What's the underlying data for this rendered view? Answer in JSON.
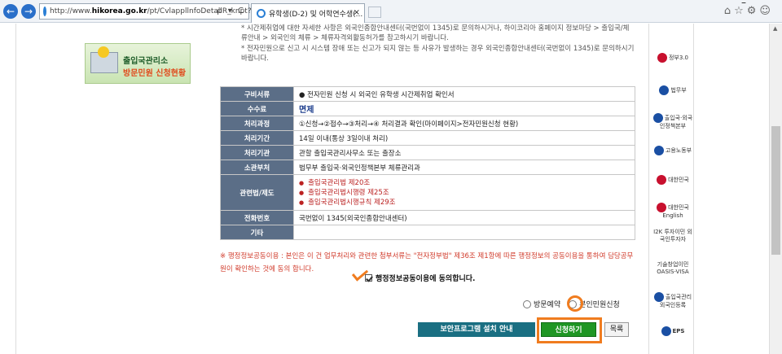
{
  "browser": {
    "url_prefix": "http://www.",
    "url_domain": "hikorea.go.kr",
    "url_rest": "/pt/CvlappllnfoDetailR_kr.pt?",
    "addr_controls": "ρ ▾ C",
    "tab_title": "유학생(D-2) 및 어학연수생(...",
    "tab_close": "×",
    "tool_icons": "⌂☆⚙☺",
    "minimize": "–",
    "back": "←",
    "forward": "→"
  },
  "notice": {
    "line1": "* 시간제취업에 대한 자세한 사항은 외국인종합안내센터(국번없이 1345)로 문의하시거나, 하이코리아 홈페이지 정보마당 > 출입국/체류안내 > 외국인의 체류 > 체류자격외활동허가를 참고하시기 바랍니다.",
    "line2": "* 전자민원으로 신고 시 시스템 장애 또는 신고가 되지 않는 등 사유가 발생하는 경우 외국인종합안내센터(국번없이 1345)로 문의하시기 바랍니다."
  },
  "banner": {
    "line1": "출입국관리소",
    "line2": "방문민원 신청현황"
  },
  "rows": [
    {
      "label": "구비서류",
      "value": "●  전자민원 신청 시 외국인 유학생 시간제취업 확인서"
    },
    {
      "label": "수수료",
      "value": "면제"
    },
    {
      "label": "처리과정",
      "value": "①신청→②접수→③처리→④ 처리결과 확인(마이페이지>전자민원신청 현황)"
    },
    {
      "label": "처리기간",
      "value": "14일 이내(통상 3일이내 처리)"
    },
    {
      "label": "처리기관",
      "value": "관할 출입국관리사무소 또는 출장소"
    },
    {
      "label": "소관부처",
      "value": "법무부 출입국·외국인정책본부 체류관리과"
    },
    {
      "label": "관련법/제도",
      "laws": [
        "출입국관리법 제20조",
        "출입국관리법시행령 제25조",
        "출입국관리법시행규칙 제29조"
      ]
    },
    {
      "label": "전화번호",
      "value": "국번없이 1345(외국인종합안내센터)"
    },
    {
      "label": "기타",
      "value": ""
    }
  ],
  "warning": "※ 행정정보공동이용 : 본인은 이 건 업무처리와 관련한 첨부서류는 \"전자정부법\" 제36조 제1항에 따른 행정정보의 공동이용을 통하여 담당공무원이 확인하는 것에 동의 합니다.",
  "agree_label": "행정정보공동이용에 동의합니다.",
  "radio": {
    "visit": "방문예약",
    "self": "본인민원신청"
  },
  "buttons": {
    "security": "보안프로그램 설치 안내",
    "apply": "신청하기",
    "list": "목록"
  },
  "sidebar": [
    {
      "name": "정부3.0",
      "color": "#c8102e"
    },
    {
      "name": "법무부",
      "color": "#1a4fa3"
    },
    {
      "name": "출입국·외국인정책본부",
      "color": "#1a4fa3"
    },
    {
      "name": "고용노동부",
      "color": "#1a4fa3"
    },
    {
      "name": "대한민국",
      "color": "#c8102e"
    },
    {
      "name": "대한민국 English",
      "color": "#c8102e"
    },
    {
      "name": "I2K 투자이민 외국인투자자",
      "color": "#1a4fa3"
    },
    {
      "name": "기술창업이민 OASIS-VISA",
      "color": "#1a4fa3"
    },
    {
      "name": "출입국관리 외국인등록",
      "color": "#1a4fa3"
    },
    {
      "name": "EPS",
      "color": "#1a4fa3"
    }
  ]
}
